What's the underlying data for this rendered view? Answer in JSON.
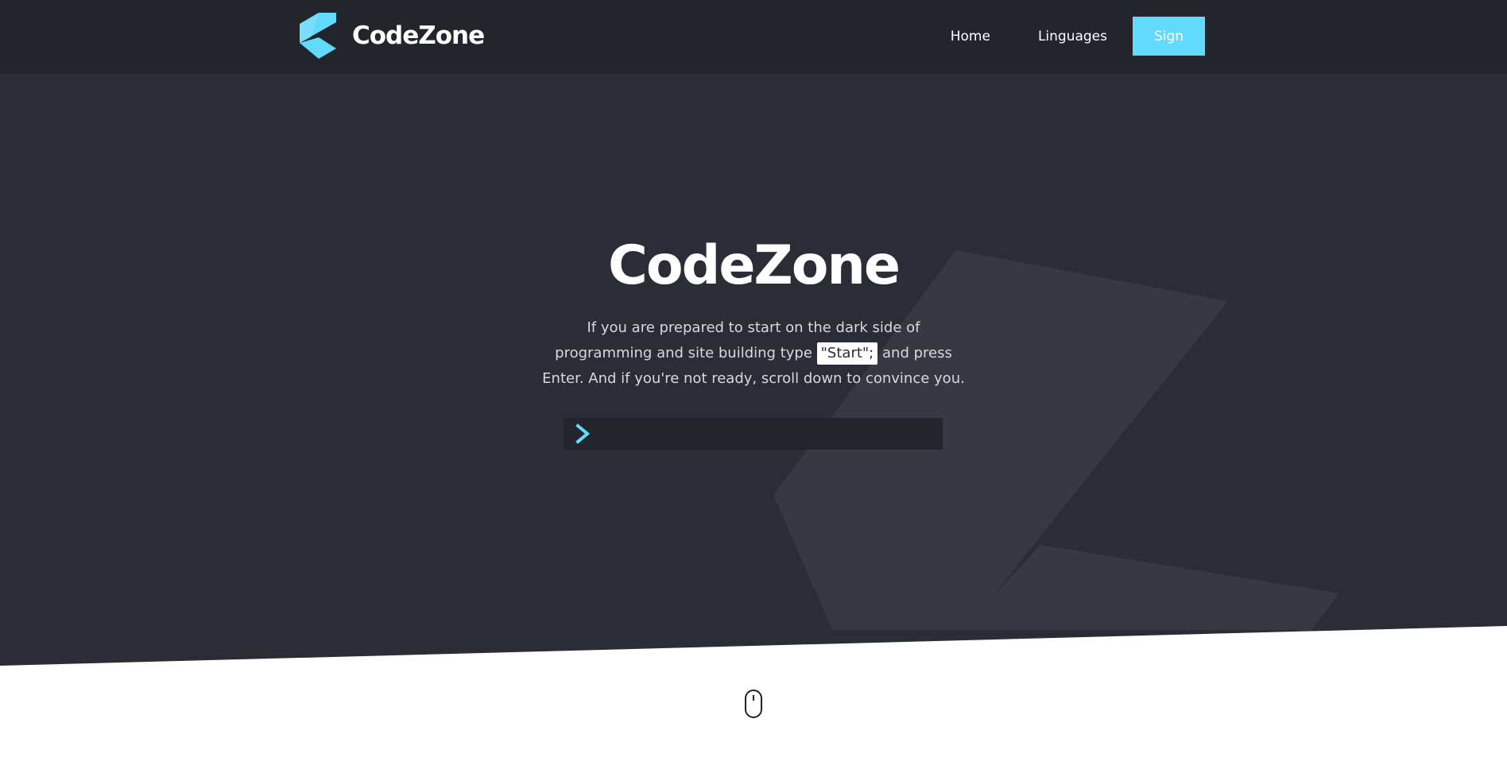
{
  "navbar": {
    "brand": "CodeZone",
    "links": [
      {
        "label": "Home"
      },
      {
        "label": "Linguages"
      }
    ],
    "sign_label": "Sign"
  },
  "hero": {
    "title": "CodeZone",
    "desc_before": "If you are prepared to start on the dark side of programming and site building type",
    "code": "\"Start\";",
    "desc_after": "and press Enter. And if you're not ready, scroll down to convince you."
  },
  "console": {
    "value": "",
    "prompt_icon": "chevron-right-icon"
  },
  "icons": {
    "logo": "codezone-logo-icon",
    "scroll": "mouse-scroll-icon"
  },
  "colors": {
    "accent": "#61dafb",
    "navbar_bg": "#22252c",
    "hero_bg": "#2a2d36"
  }
}
